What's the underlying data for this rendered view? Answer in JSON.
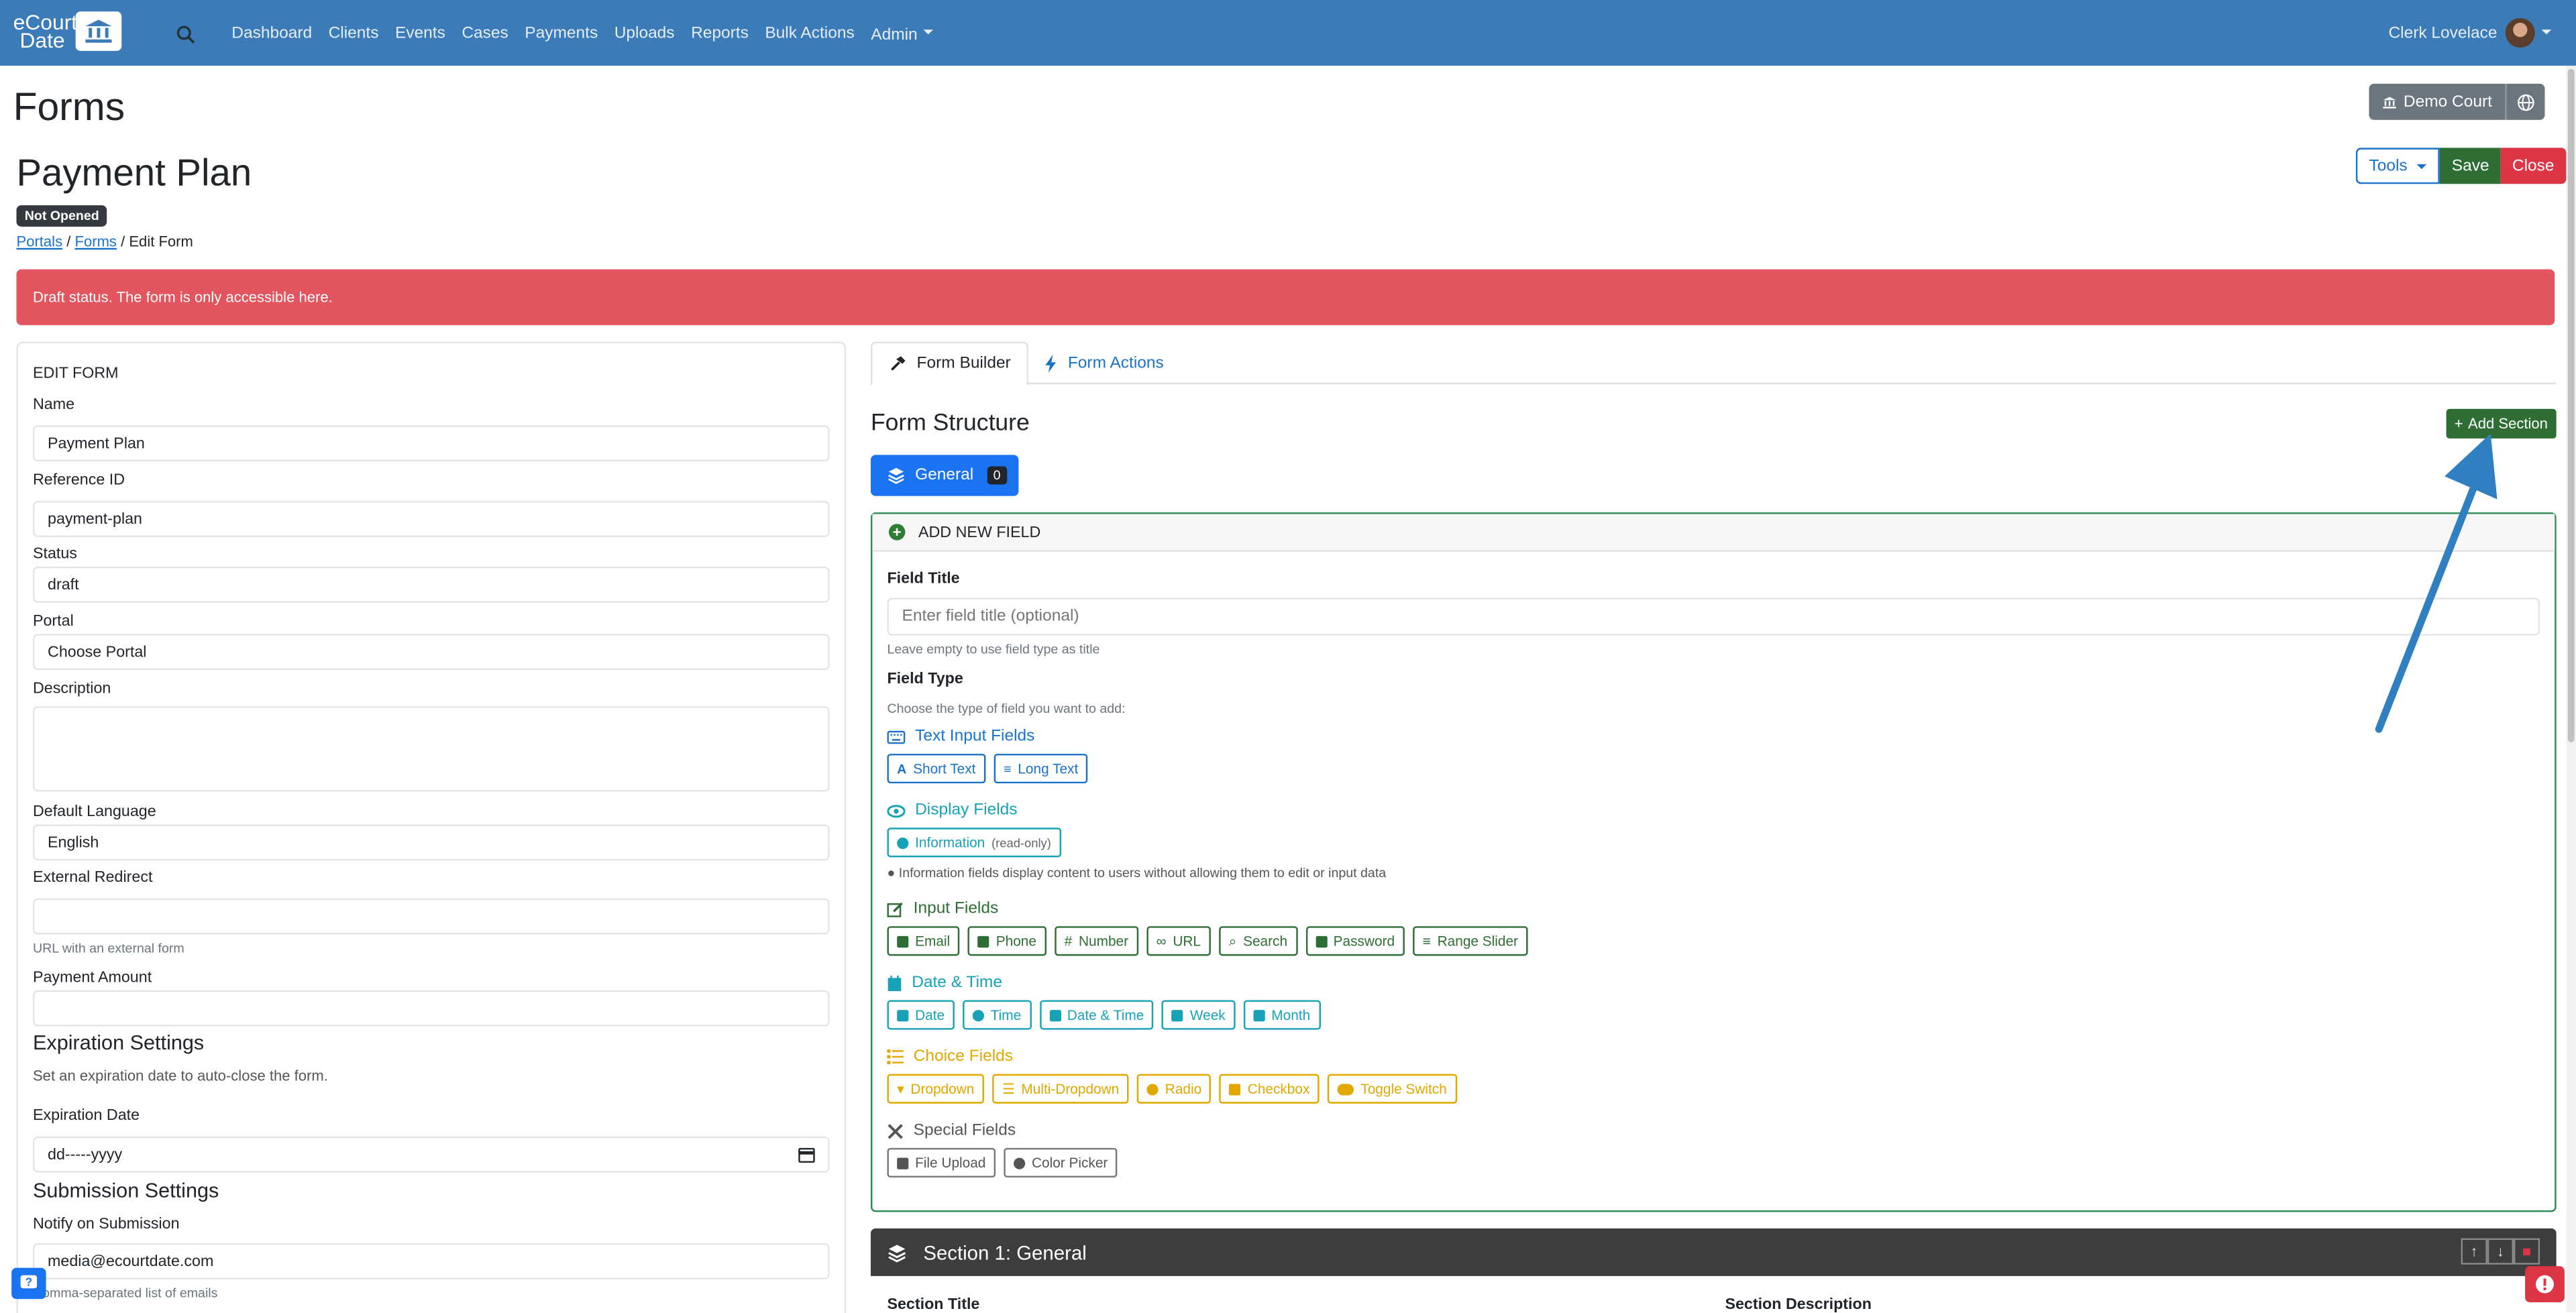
{
  "navbar": {
    "brand_line1": "eCourt",
    "brand_line2": "Date",
    "links": [
      "Dashboard",
      "Clients",
      "Events",
      "Cases",
      "Payments",
      "Uploads",
      "Reports",
      "Bulk Actions",
      "Admin"
    ],
    "user_name": "Clerk Lovelace"
  },
  "header": {
    "page_title": "Forms",
    "form_title": "Payment Plan",
    "status_badge": "Not Opened",
    "breadcrumb": {
      "portals": "Portals",
      "sep1": " / ",
      "forms": "Forms",
      "sep2": " / ",
      "current": "Edit Form"
    },
    "court_button": "Demo Court",
    "tools_button": "Tools",
    "save_button": "Save",
    "close_button": "Close"
  },
  "alert": {
    "text": "Draft status. The form is only accessible here."
  },
  "edit_form": {
    "heading": "EDIT FORM",
    "name_label": "Name",
    "name_value": "Payment Plan",
    "refid_label": "Reference ID",
    "refid_value": "payment-plan",
    "status_label": "Status",
    "status_value": "draft",
    "portal_label": "Portal",
    "portal_value": "Choose Portal",
    "description_label": "Description",
    "language_label": "Default Language",
    "language_value": "English",
    "redirect_label": "External Redirect",
    "redirect_hint": "URL with an external form",
    "payment_label": "Payment Amount",
    "expiration_heading": "Expiration Settings",
    "expiration_desc": "Set an expiration date to auto-close the form.",
    "expiration_label": "Expiration Date",
    "expiration_value": "dd-----yyyy",
    "submission_heading": "Submission Settings",
    "notify_label": "Notify on Submission",
    "notify_value": "media@ecourtdate.com",
    "notify_hint": "Comma-separated list of emails"
  },
  "builder": {
    "tab_builder": "Form Builder",
    "tab_actions": "Form Actions",
    "structure_title": "Form Structure",
    "add_section": "Add Section",
    "general_label": "General",
    "general_count": "0",
    "add_field_heading": "ADD NEW FIELD",
    "field_title_label": "Field Title",
    "field_title_placeholder": "Enter field title (optional)",
    "field_title_hint": "Leave empty to use field type as title",
    "field_type_label": "Field Type",
    "field_type_hint": "Choose the type of field you want to add:",
    "text_input_heading": "Text Input Fields",
    "text_input_chips": [
      "Short Text",
      "Long Text"
    ],
    "display_heading": "Display Fields",
    "display_chip": "Information",
    "display_chip_suffix": "(read-only)",
    "display_hint": "Information fields display content to users without allowing them to edit or input data",
    "input_heading": "Input Fields",
    "input_chips": [
      "Email",
      "Phone",
      "Number",
      "URL",
      "Search",
      "Password",
      "Range Slider"
    ],
    "datetime_heading": "Date & Time",
    "datetime_chips": [
      "Date",
      "Time",
      "Date & Time",
      "Week",
      "Month"
    ],
    "choice_heading": "Choice Fields",
    "choice_chips": [
      "Dropdown",
      "Multi-Dropdown",
      "Radio",
      "Checkbox",
      "Toggle Switch"
    ],
    "special_heading": "Special Fields",
    "special_chips": [
      "File Upload",
      "Color Picker"
    ],
    "section_title": "Section 1: General",
    "section_title_label": "Section Title",
    "section_desc_label": "Section Description"
  },
  "colors": {
    "navbar": "#3b7bb8",
    "alert": "#e2545e",
    "primary": "#1a73f0",
    "success": "#2e6e34",
    "danger": "#dc3545",
    "arrow": "#2f7fc1"
  },
  "icons": [
    "search-icon",
    "bank-icon",
    "globe-icon",
    "hammer-icon",
    "bolt-icon",
    "layers-icon",
    "plus-icon",
    "keyboard-icon",
    "eye-icon",
    "edit-icon",
    "calendar-icon",
    "list-icon",
    "tools-icon",
    "help-icon",
    "alert-icon"
  ]
}
